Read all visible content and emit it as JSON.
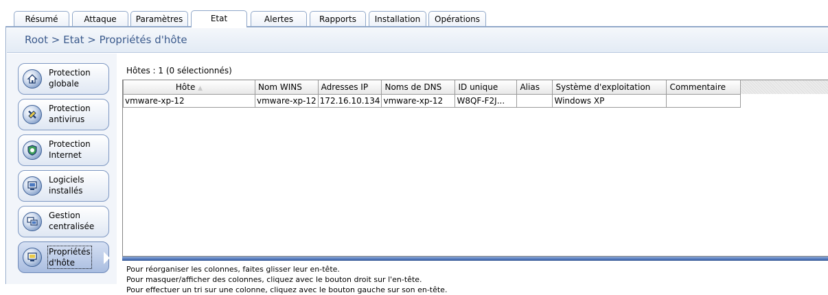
{
  "tabs": [
    {
      "label": "Résumé",
      "active": false
    },
    {
      "label": "Attaque",
      "active": false
    },
    {
      "label": "Paramètres",
      "active": false
    },
    {
      "label": "Etat",
      "active": true
    },
    {
      "label": "Alertes",
      "active": false
    },
    {
      "label": "Rapports",
      "active": false
    },
    {
      "label": "Installation",
      "active": false
    },
    {
      "label": "Opérations",
      "active": false
    }
  ],
  "breadcrumb": "Root > Etat > Propriétés d'hôte",
  "sidebar": {
    "items": [
      {
        "line1": "Protection",
        "line2": "globale",
        "icon": "house-icon",
        "selected": false
      },
      {
        "line1": "Protection",
        "line2": "antivirus",
        "icon": "antivirus-icon",
        "selected": false
      },
      {
        "line1": "Protection",
        "line2": "Internet",
        "icon": "internet-shield-icon",
        "selected": false
      },
      {
        "line1": "Logiciels",
        "line2": "installés",
        "icon": "software-icon",
        "selected": false
      },
      {
        "line1": "Gestion",
        "line2": "centralisée",
        "icon": "computers-icon",
        "selected": false
      },
      {
        "line1": "Propriétés",
        "line2": "d'hôte",
        "icon": "host-properties-icon",
        "selected": true
      }
    ]
  },
  "grid": {
    "count_label": "Hôtes : 1 (0 sélectionnés)",
    "columns": [
      "Hôte",
      "Nom WINS",
      "Adresses IP",
      "Noms de DNS",
      "ID unique",
      "Alias",
      "Système d'exploitation",
      "Commentaire"
    ],
    "sorted_column": "Hôte",
    "sort_indicator": "▲",
    "rows": [
      [
        "vmware-xp-12",
        "vmware-xp-12",
        "172.16.10.134",
        "vmware-xp-12",
        "W8QF-F2J...",
        "",
        "Windows XP",
        ""
      ]
    ]
  },
  "help": {
    "line1": "Pour réorganiser les colonnes, faites glisser leur en-tête.",
    "line2": "Pour masquer/afficher des colonnes, cliquez avec le bouton droit sur l'en-tête.",
    "line3": "Pour effectuer un tri sur une colonne, cliquez avec le bouton gauche sur son en-tête."
  },
  "colors": {
    "accent": "#3b5a8c",
    "splitter": "#3f68b1",
    "selected_sidebar": "#a9bde0"
  }
}
